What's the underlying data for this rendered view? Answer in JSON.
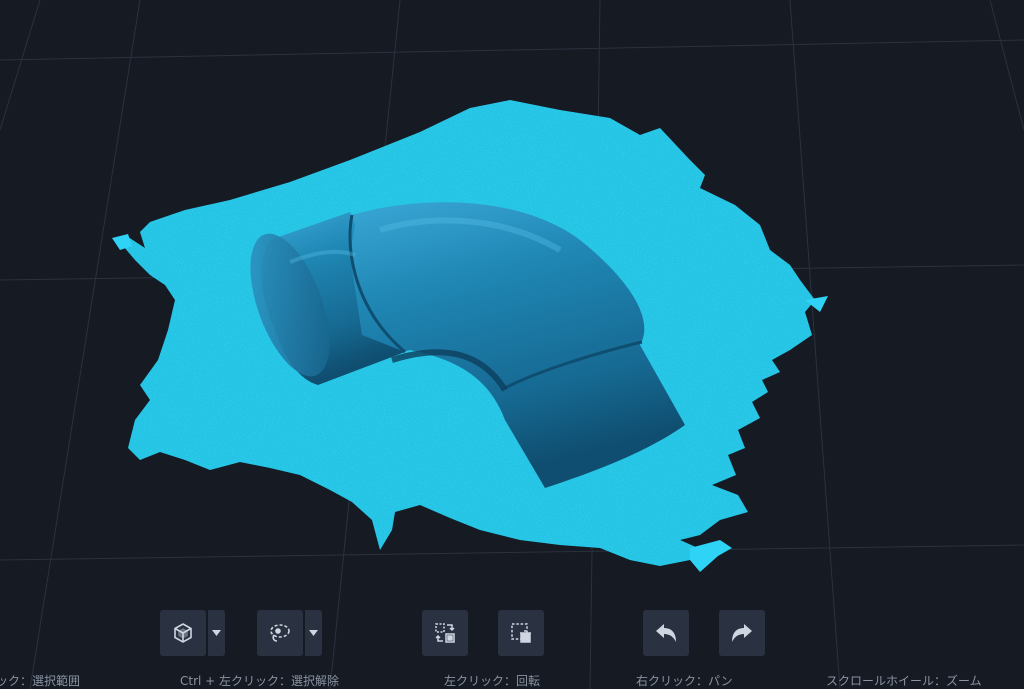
{
  "colors": {
    "background": "#151a23",
    "grid_line": "#2b323e",
    "scan_mesh": "#2fd3f5",
    "pipe_body": "#1f86b3",
    "button_bg": "#2a3140",
    "icon": "#cfd6e2",
    "hint_text": "#8a93a3"
  },
  "toolbar": {
    "buttons": [
      {
        "name": "select-mode-button",
        "icon": "cube-select-icon",
        "has_dropdown": true
      },
      {
        "name": "lasso-mode-button",
        "icon": "lasso-icon",
        "has_dropdown": true
      },
      {
        "name": "invert-selection-button",
        "icon": "invert-selection-icon",
        "has_dropdown": false
      },
      {
        "name": "delete-selection-button",
        "icon": "delete-selection-icon",
        "has_dropdown": false
      },
      {
        "name": "undo-button",
        "icon": "undo-icon",
        "has_dropdown": false
      },
      {
        "name": "redo-button",
        "icon": "redo-icon",
        "has_dropdown": false
      }
    ]
  },
  "hints": {
    "select_range": "ック：選択範囲",
    "deselect": "Ctrl + 左クリック：選択解除",
    "rotate": "左クリック：回転",
    "pan": "右クリック：パン",
    "zoom": "スクロールホイール：ズーム"
  }
}
